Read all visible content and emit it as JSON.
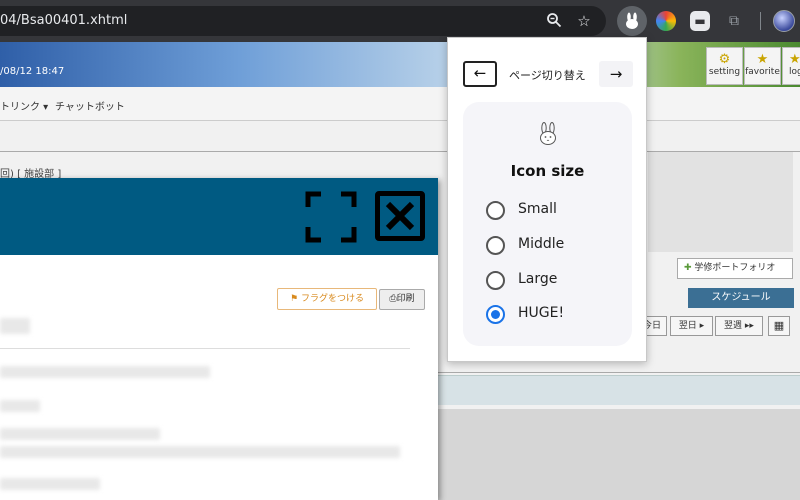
{
  "browser": {
    "url": "04/Bsa00401.xhtml",
    "zoom_icon": "zoom-icon",
    "bookmark_icon": "star-icon"
  },
  "page": {
    "banner_date": "/08/12 18:47",
    "top_buttons": [
      {
        "label": "setting",
        "icon": "gear-icon"
      },
      {
        "label": "favorite",
        "icon": "star-icon"
      },
      {
        "label": "log",
        "icon": "logout-icon"
      }
    ],
    "menu": {
      "link_menu": "トリンク ▾",
      "chatbot": "チャットボット"
    },
    "breadcrumb": "回) [ 施設部 ]",
    "portfolio_button": "学修ポートフォリオ",
    "schedule_tab": "スケジュール",
    "nav_buttons": {
      "today": "今日",
      "next_day": "翌日 ▸",
      "next_week": "翌週 ▸▸"
    }
  },
  "modal": {
    "flag_button": "フラグをつける",
    "print_button": "印刷"
  },
  "popup": {
    "prev_arrow": "←",
    "title": "ページ切り替え",
    "next_arrow": "→",
    "card_title": "Icon size",
    "options": [
      {
        "label": "Small",
        "checked": false
      },
      {
        "label": "Middle",
        "checked": false
      },
      {
        "label": "Large",
        "checked": false
      },
      {
        "label": "HUGE!",
        "checked": true
      }
    ]
  },
  "colors": {
    "modal_header": "#005a82",
    "radio_checked": "#1a73e8",
    "schedule_tab": "#3b6f94"
  }
}
